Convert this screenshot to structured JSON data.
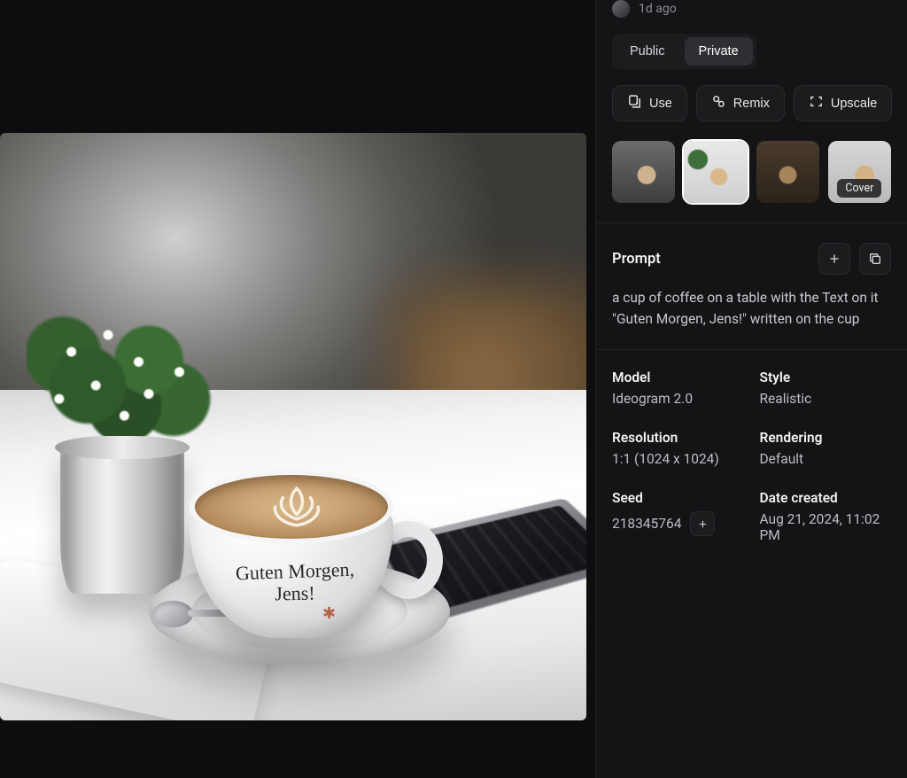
{
  "meta": {
    "timestamp": "1d ago"
  },
  "visibility": {
    "public": "Public",
    "private": "Private",
    "active": "private"
  },
  "actions": {
    "use": "Use",
    "remix": "Remix",
    "upscale": "Upscale"
  },
  "thumbnails": {
    "cover_label": "Cover",
    "selected_index": 1
  },
  "prompt": {
    "heading": "Prompt",
    "text": "a cup of coffee on a table with the Text on it \"Guten Morgen, Jens!\" written on the cup"
  },
  "details": {
    "model": {
      "label": "Model",
      "value": "Ideogram 2.0"
    },
    "style": {
      "label": "Style",
      "value": "Realistic"
    },
    "resolution": {
      "label": "Resolution",
      "value": "1:1 (1024 x 1024)"
    },
    "rendering": {
      "label": "Rendering",
      "value": "Default"
    },
    "seed": {
      "label": "Seed",
      "value": "218345764"
    },
    "date": {
      "label": "Date created",
      "value": "Aug 21, 2024, 11:02 PM"
    }
  },
  "image_text": {
    "line1": "Guten Morgen,",
    "line2": "Jens!"
  }
}
